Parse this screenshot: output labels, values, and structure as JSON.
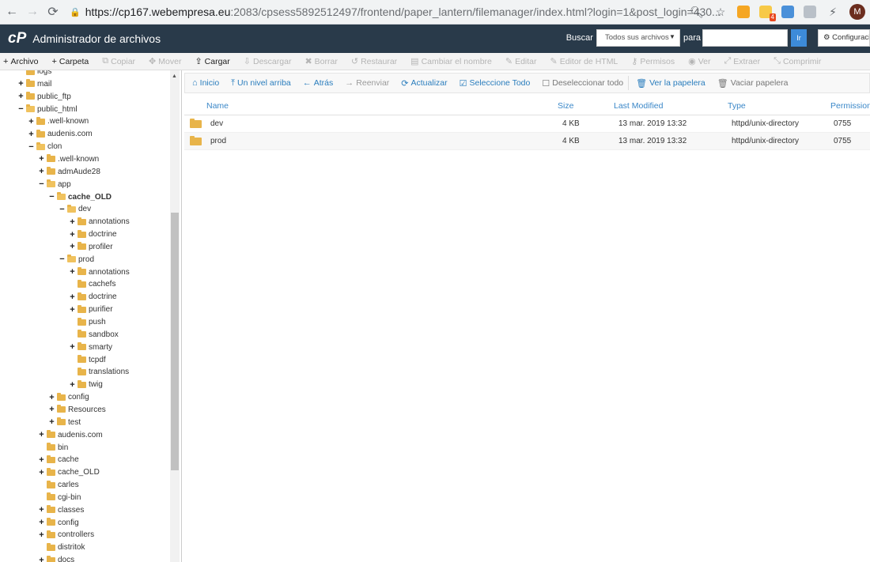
{
  "browser": {
    "url_host": "https://cp167.webempresa.eu",
    "url_rest": ":2083/cpsess5892512497/frontend/paper_lantern/filemanager/index.html?login=1&post_login=430...",
    "ext_badge": "4",
    "avatar_letter": "M"
  },
  "header": {
    "logo": "cP",
    "title": "Administrador de archivos",
    "search_label": "Buscar",
    "search_scope": "Todos sus archivos",
    "for_label": "para",
    "go_label": "Ir",
    "settings_label": "Configuración"
  },
  "toolbar": [
    {
      "icon": "+",
      "label": "Archivo",
      "enabled": true,
      "name": "new-file-button"
    },
    {
      "icon": "+",
      "label": "Carpeta",
      "enabled": true,
      "name": "new-folder-button"
    },
    {
      "icon": "⧉",
      "label": "Copiar",
      "enabled": false,
      "name": "copy-button"
    },
    {
      "icon": "✥",
      "label": "Mover",
      "enabled": false,
      "name": "move-button"
    },
    {
      "icon": "⇪",
      "label": "Cargar",
      "enabled": true,
      "name": "upload-button"
    },
    {
      "icon": "⇩",
      "label": "Descargar",
      "enabled": false,
      "name": "download-button"
    },
    {
      "icon": "✖",
      "label": "Borrar",
      "enabled": false,
      "name": "delete-button"
    },
    {
      "icon": "↺",
      "label": "Restaurar",
      "enabled": false,
      "name": "restore-button"
    },
    {
      "icon": "▤",
      "label": "Cambiar el nombre",
      "enabled": false,
      "name": "rename-button"
    },
    {
      "icon": "✎",
      "label": "Editar",
      "enabled": false,
      "name": "edit-button"
    },
    {
      "icon": "✎",
      "label": "Editor de HTML",
      "enabled": false,
      "name": "html-editor-button"
    },
    {
      "icon": "⚷",
      "label": "Permisos",
      "enabled": false,
      "name": "permissions-button"
    },
    {
      "icon": "◉",
      "label": "Ver",
      "enabled": false,
      "name": "view-button"
    },
    {
      "icon": "⤢",
      "label": "Extraer",
      "enabled": false,
      "name": "extract-button"
    },
    {
      "icon": "⤡",
      "label": "Comprimir",
      "enabled": false,
      "name": "compress-button"
    }
  ],
  "tree": [
    {
      "label": "logs",
      "level": 1,
      "toggle": "",
      "open": false
    },
    {
      "label": "mail",
      "level": 1,
      "toggle": "+",
      "open": false
    },
    {
      "label": "public_ftp",
      "level": 1,
      "toggle": "+",
      "open": false
    },
    {
      "label": "public_html",
      "level": 1,
      "toggle": "−",
      "open": true
    },
    {
      "label": ".well-known",
      "level": 2,
      "toggle": "+",
      "open": false
    },
    {
      "label": "audenis.com",
      "level": 2,
      "toggle": "+",
      "open": false
    },
    {
      "label": "clon",
      "level": 2,
      "toggle": "−",
      "open": true
    },
    {
      "label": ".well-known",
      "level": 3,
      "toggle": "+",
      "open": false
    },
    {
      "label": "admAude28",
      "level": 3,
      "toggle": "+",
      "open": false
    },
    {
      "label": "app",
      "level": 3,
      "toggle": "−",
      "open": true
    },
    {
      "label": "cache_OLD",
      "level": 4,
      "toggle": "−",
      "open": true,
      "selected": true
    },
    {
      "label": "dev",
      "level": 5,
      "toggle": "−",
      "open": true
    },
    {
      "label": "annotations",
      "level": 6,
      "toggle": "+",
      "open": false
    },
    {
      "label": "doctrine",
      "level": 6,
      "toggle": "+",
      "open": false
    },
    {
      "label": "profiler",
      "level": 6,
      "toggle": "+",
      "open": false
    },
    {
      "label": "prod",
      "level": 5,
      "toggle": "−",
      "open": true
    },
    {
      "label": "annotations",
      "level": 6,
      "toggle": "+",
      "open": false
    },
    {
      "label": "cachefs",
      "level": 6,
      "toggle": "",
      "open": false
    },
    {
      "label": "doctrine",
      "level": 6,
      "toggle": "+",
      "open": false
    },
    {
      "label": "purifier",
      "level": 6,
      "toggle": "+",
      "open": false
    },
    {
      "label": "push",
      "level": 6,
      "toggle": "",
      "open": false
    },
    {
      "label": "sandbox",
      "level": 6,
      "toggle": "",
      "open": false
    },
    {
      "label": "smarty",
      "level": 6,
      "toggle": "+",
      "open": false
    },
    {
      "label": "tcpdf",
      "level": 6,
      "toggle": "",
      "open": false
    },
    {
      "label": "translations",
      "level": 6,
      "toggle": "",
      "open": false
    },
    {
      "label": "twig",
      "level": 6,
      "toggle": "+",
      "open": false
    },
    {
      "label": "config",
      "level": 4,
      "toggle": "+",
      "open": false
    },
    {
      "label": "Resources",
      "level": 4,
      "toggle": "+",
      "open": false
    },
    {
      "label": "test",
      "level": 4,
      "toggle": "+",
      "open": false
    },
    {
      "label": "audenis.com",
      "level": 3,
      "toggle": "+",
      "open": false
    },
    {
      "label": "bin",
      "level": 3,
      "toggle": "",
      "open": false
    },
    {
      "label": "cache",
      "level": 3,
      "toggle": "+",
      "open": false
    },
    {
      "label": "cache_OLD",
      "level": 3,
      "toggle": "+",
      "open": false
    },
    {
      "label": "carles",
      "level": 3,
      "toggle": "",
      "open": false
    },
    {
      "label": "cgi-bin",
      "level": 3,
      "toggle": "",
      "open": false
    },
    {
      "label": "classes",
      "level": 3,
      "toggle": "+",
      "open": false
    },
    {
      "label": "config",
      "level": 3,
      "toggle": "+",
      "open": false
    },
    {
      "label": "controllers",
      "level": 3,
      "toggle": "+",
      "open": false
    },
    {
      "label": "distritok",
      "level": 3,
      "toggle": "",
      "open": false
    },
    {
      "label": "docs",
      "level": 3,
      "toggle": "+",
      "open": false
    }
  ],
  "path_toolbar": [
    {
      "icon": "⌂",
      "label": "Inicio",
      "state": "link",
      "name": "home-button"
    },
    {
      "icon": "⤒",
      "label": "Un nivel arriba",
      "state": "link",
      "name": "up-one-level-button"
    },
    {
      "icon": "←",
      "label": "Atrás",
      "state": "link",
      "name": "back-button"
    },
    {
      "icon": "→",
      "label": "Reenviar",
      "state": "dis",
      "name": "forward-button"
    },
    {
      "icon": "⟳",
      "label": "Actualizar",
      "state": "link",
      "name": "reload-button"
    },
    {
      "icon": "☑",
      "label": "Seleccione Todo",
      "state": "link",
      "name": "select-all-button"
    },
    {
      "icon": "☐",
      "label": "Deseleccionar todo",
      "state": "gray",
      "name": "deselect-all-button",
      "sep_after": true
    },
    {
      "icon": "🗑",
      "label": "Ver la papelera",
      "state": "link",
      "name": "view-trash-button"
    },
    {
      "icon": "🗑",
      "label": "Vaciar papelera",
      "state": "gray",
      "name": "empty-trash-button"
    }
  ],
  "table": {
    "columns": [
      "Name",
      "Size",
      "Last Modified",
      "Type",
      "Permissions"
    ],
    "rows": [
      {
        "name": "dev",
        "size": "4 KB",
        "modified": "13 mar. 2019 13:32",
        "type": "httpd/unix-directory",
        "perms": "0755"
      },
      {
        "name": "prod",
        "size": "4 KB",
        "modified": "13 mar. 2019 13:32",
        "type": "httpd/unix-directory",
        "perms": "0755"
      }
    ]
  },
  "colors": {
    "header_bg": "#293a4a",
    "link": "#2a7dbd",
    "folder": "#e8b44a"
  }
}
